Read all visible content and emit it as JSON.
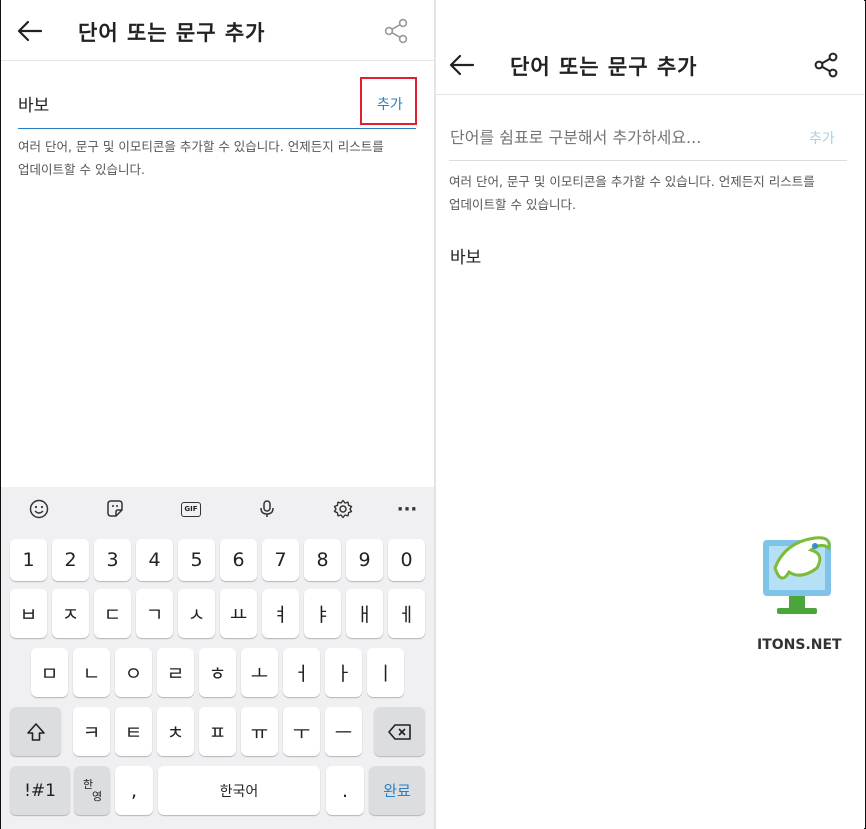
{
  "left": {
    "title": "단어 또는 문구 추가",
    "input_value": "바보",
    "add_label": "추가",
    "help_line1": "여러 단어, 문구 및 이모티콘을 추가할 수 있습니다. 언제든지 리스트를",
    "help_line2": "업데이트할 수 있습니다."
  },
  "right": {
    "title": "단어 또는 문구 추가",
    "input_placeholder": "단어를 쉼표로 구분해서 추가하세요...",
    "add_label": "추가",
    "help_line1": "여러 단어, 문구 및 이모티콘을 추가할 수 있습니다. 언제든지 리스트를",
    "help_line2": "업데이트할 수 있습니다.",
    "list_items": [
      "바보"
    ]
  },
  "keyboard": {
    "toolbar_icons": [
      "emoji-icon",
      "sticker-icon",
      "gif-icon",
      "mic-icon",
      "settings-icon",
      "more-icon"
    ],
    "gif_label": "GIF",
    "number_row": [
      "1",
      "2",
      "3",
      "4",
      "5",
      "6",
      "7",
      "8",
      "9",
      "0"
    ],
    "row1": [
      "ㅂ",
      "ㅈ",
      "ㄷ",
      "ㄱ",
      "ㅅ",
      "ㅛ",
      "ㅕ",
      "ㅑ",
      "ㅐ",
      "ㅔ"
    ],
    "row2": [
      "ㅁ",
      "ㄴ",
      "ㅇ",
      "ㄹ",
      "ㅎ",
      "ㅗ",
      "ㅓ",
      "ㅏ",
      "ㅣ"
    ],
    "row3": [
      "ㅋ",
      "ㅌ",
      "ㅊ",
      "ㅍ",
      "ㅠ",
      "ㅜ",
      "ㅡ"
    ],
    "symbols_label": "!#1",
    "lang_top": "한",
    "lang_bottom": "영",
    "comma": ",",
    "space_label": "한국어",
    "period": ".",
    "done_label": "완료"
  },
  "watermark": {
    "text": "ITONS.NET"
  },
  "colors": {
    "accent": "#2c7fbf",
    "accent_faded": "#a9cfe6",
    "highlight_box": "#e0202a"
  }
}
